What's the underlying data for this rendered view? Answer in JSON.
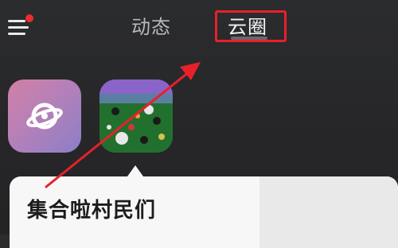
{
  "header": {
    "tabs": [
      {
        "label": "动态",
        "selected": false
      },
      {
        "label": "云圈",
        "selected": true
      }
    ],
    "menu_has_notification": true
  },
  "apps": [
    {
      "icon": "planet-icon"
    },
    {
      "icon": "game-thumbnail-icon"
    }
  ],
  "card": {
    "title": "集合啦村民们"
  },
  "colors": {
    "highlight": "#e8202a",
    "notification_dot": "#ee2b33",
    "background": "#262628"
  }
}
